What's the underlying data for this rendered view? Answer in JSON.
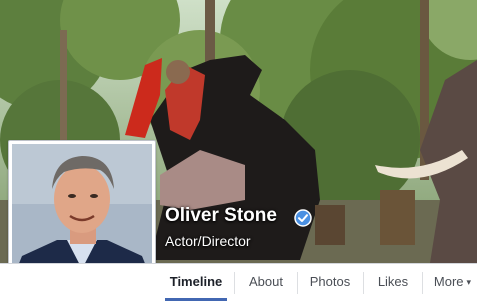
{
  "profile": {
    "name": "Oliver Stone",
    "subtitle": "Actor/Director",
    "verified": true
  },
  "nav": {
    "tabs": [
      {
        "label": "Timeline",
        "active": true
      },
      {
        "label": "About"
      },
      {
        "label": "Photos"
      },
      {
        "label": "Likes"
      },
      {
        "label": "More"
      }
    ],
    "more_caret": "▾"
  },
  "colors": {
    "accent": "#4267b2",
    "verified_badge": "#4a90e2"
  },
  "icons": {
    "verified": "verified-check-icon",
    "more": "caret-down-icon"
  }
}
